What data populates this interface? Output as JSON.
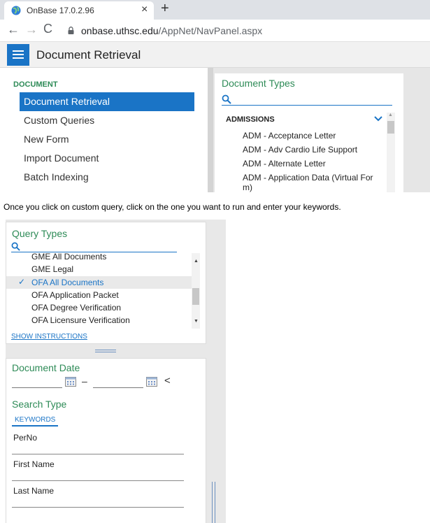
{
  "browser": {
    "tab_title": "OnBase 17.0.2.96",
    "tab_close": "×",
    "new_tab": "+",
    "back": "←",
    "forward": "→",
    "reload": "C",
    "url_host": "onbase.uthsc.edu",
    "url_path": "/AppNet/NavPanel.aspx"
  },
  "header": {
    "title": "Document Retrieval"
  },
  "left_nav": {
    "section": "DOCUMENT",
    "items": [
      "Document Retrieval",
      "Custom Queries",
      "New Form",
      "Import Document",
      "Batch Indexing"
    ],
    "active_index": 0
  },
  "document_types": {
    "title": "Document Types",
    "group": "ADMISSIONS",
    "items": [
      "ADM - Acceptance Letter",
      "ADM - Adv Cardio Life Support",
      "ADM - Alternate Letter",
      "ADM - Application Data (Virtual For",
      "m)"
    ]
  },
  "instruction": "Once you click on custom query, click on the one you want to run and enter your keywords.",
  "query_types": {
    "title": "Query Types",
    "items": [
      "GME All Documents",
      "GME Legal",
      "OFA All Documents",
      "OFA Application Packet",
      "OFA Degree Verification",
      "OFA Licensure Verification"
    ],
    "selected_index": 2,
    "check": "✓",
    "show_instructions": "SHOW INSTRUCTIONS"
  },
  "search_panel": {
    "date_title": "Document Date",
    "date_separator": "–",
    "collapse": "<",
    "search_type_title": "Search Type",
    "keywords_tab": "KEYWORDS",
    "fields": [
      "PerNo",
      "First Name",
      "Last Name"
    ]
  },
  "colors": {
    "accent": "#1a74c6",
    "heading_green": "#2e8b57"
  },
  "icons": [
    "globe-icon",
    "close-icon",
    "plus-icon",
    "back-arrow-icon",
    "forward-arrow-icon",
    "reload-icon",
    "lock-icon",
    "hamburger-icon",
    "search-icon",
    "chevron-down-icon",
    "checkmark-icon",
    "calendar-icon",
    "chevron-left-icon"
  ]
}
